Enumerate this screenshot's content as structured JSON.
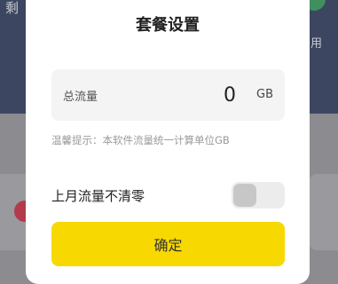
{
  "background": {
    "left_text": "剩",
    "right_text": "用"
  },
  "dialog": {
    "title": "套餐设置",
    "total": {
      "label": "总流量",
      "value": "0",
      "unit": "GB"
    },
    "hint": "温馨提示：本软件流量统一计算单位GB",
    "keep_last_month": {
      "label": "上月流量不清零",
      "enabled": false
    },
    "confirm_label": "确定"
  },
  "colors": {
    "accent": "#f7d800",
    "header": "#3d4660"
  }
}
